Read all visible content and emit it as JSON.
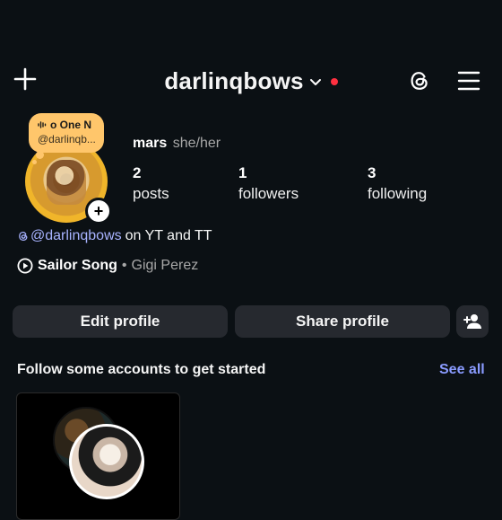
{
  "header": {
    "username": "darlinqbows",
    "icons": [
      "plus-icon",
      "chevron-down-icon",
      "threads-icon",
      "menu-icon"
    ],
    "notification_dot_color": "#ff3040"
  },
  "note": {
    "line1": "o One N",
    "line2": "@darlinqb..."
  },
  "profile": {
    "name": "mars",
    "pronouns": "she/her",
    "stats": {
      "posts": {
        "count": "2",
        "label": "posts"
      },
      "followers": {
        "count": "1",
        "label": "followers"
      },
      "following": {
        "count": "3",
        "label": "following"
      }
    },
    "add_story_symbol": "+"
  },
  "bio": {
    "handle": "@darlinqbows",
    "rest": "on YT and TT"
  },
  "music": {
    "title": "Sailor Song",
    "separator": "•",
    "artist": "Gigi Perez"
  },
  "buttons": {
    "edit_profile": "Edit profile",
    "share_profile": "Share profile"
  },
  "suggestions": {
    "title": "Follow some accounts to get started",
    "see_all": "See all"
  },
  "colors": {
    "background": "#0b1014",
    "link": "#a8b3ff",
    "see_all": "#8a9bff",
    "note": "#ffc66b",
    "button": "#26292f"
  }
}
